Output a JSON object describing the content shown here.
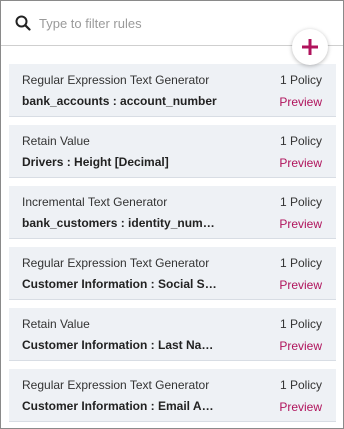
{
  "search": {
    "placeholder": "Type to filter rules",
    "value": ""
  },
  "add_button": {
    "icon": "plus-icon",
    "color": "#b0135c"
  },
  "rules": [
    {
      "name": "Regular Expression Text Generator",
      "target": "bank_accounts : account_number",
      "policy_count": "1 Policy",
      "preview_label": "Preview"
    },
    {
      "name": "Retain Value",
      "target": "Drivers : Height [Decimal]",
      "policy_count": "1 Policy",
      "preview_label": "Preview"
    },
    {
      "name": "Incremental Text Generator",
      "target": "bank_customers : identity_number",
      "policy_count": "1 Policy",
      "preview_label": "Preview"
    },
    {
      "name": "Regular Expression Text Generator",
      "target": "Customer Information : Social Security Number",
      "policy_count": "1 Policy",
      "preview_label": "Preview"
    },
    {
      "name": "Retain Value",
      "target": "Customer Information : Last Name",
      "policy_count": "1 Policy",
      "preview_label": "Preview"
    },
    {
      "name": "Regular Expression Text Generator",
      "target": "Customer Information : Email Address",
      "policy_count": "1 Policy",
      "preview_label": "Preview"
    }
  ],
  "colors": {
    "accent": "#b0135c",
    "card_background": "#eef1f5"
  }
}
